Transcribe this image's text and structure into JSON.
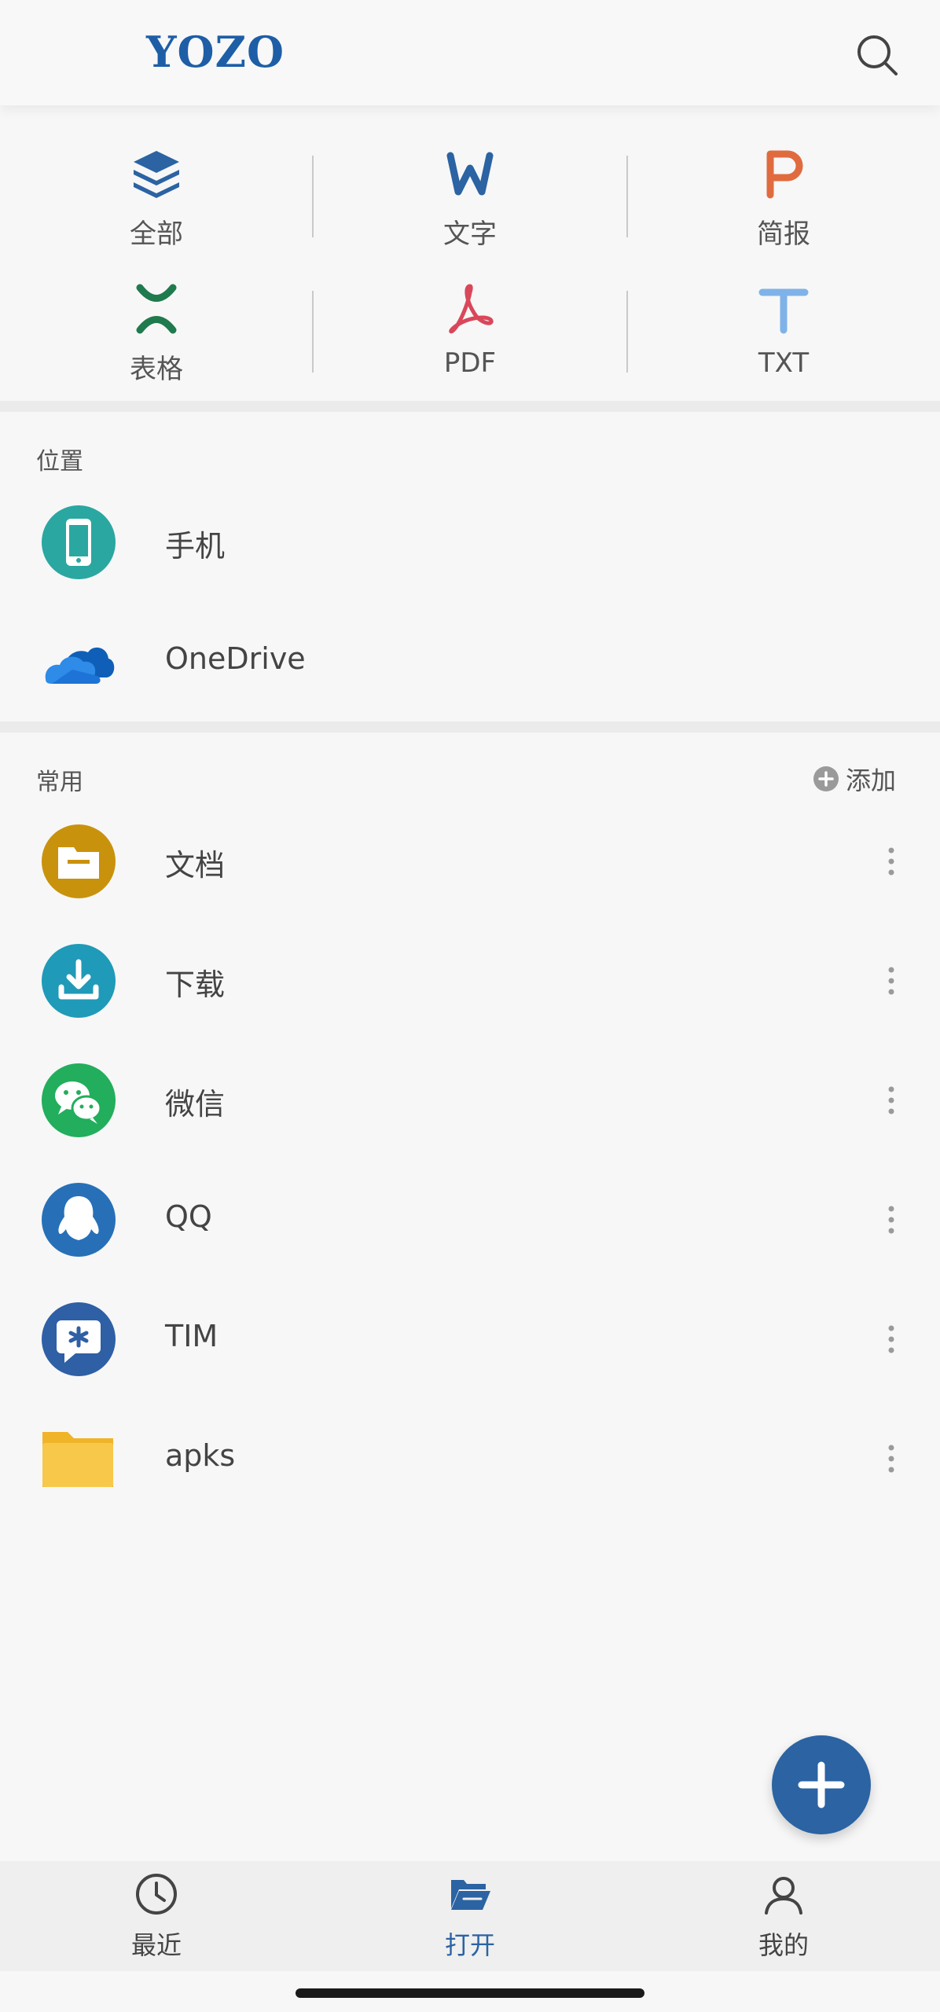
{
  "header": {
    "logo_text": "YOZO",
    "search_icon": "search-icon"
  },
  "categories": [
    {
      "label": "全部",
      "icon": "layers-icon",
      "color": "#2b63a3"
    },
    {
      "label": "文字",
      "icon": "word-icon",
      "color": "#2b63a3"
    },
    {
      "label": "简报",
      "icon": "presentation-icon",
      "color": "#e06b3f"
    },
    {
      "label": "表格",
      "icon": "spreadsheet-icon",
      "color": "#1f7a4d"
    },
    {
      "label": "PDF",
      "icon": "pdf-icon",
      "color": "#d9475a"
    },
    {
      "label": "TXT",
      "icon": "text-icon",
      "color": "#7fb2e8"
    }
  ],
  "locations": {
    "title": "位置",
    "items": [
      {
        "label": "手机",
        "icon": "phone-icon",
        "color": "#2aa7a0"
      },
      {
        "label": "OneDrive",
        "icon": "onedrive-icon",
        "color": "#1e72d6"
      }
    ]
  },
  "favorites": {
    "title": "常用",
    "add_label": "添加",
    "items": [
      {
        "label": "文档",
        "icon": "documents-folder-icon",
        "color": "#c9920d"
      },
      {
        "label": "下载",
        "icon": "download-icon",
        "color": "#1f9ab8"
      },
      {
        "label": "微信",
        "icon": "wechat-icon",
        "color": "#22ae5c"
      },
      {
        "label": "QQ",
        "icon": "qq-icon",
        "color": "#2770b8"
      },
      {
        "label": "TIM",
        "icon": "tim-icon",
        "color": "#2f5fa5"
      },
      {
        "label": "apks",
        "icon": "folder-icon",
        "color": "#f7c84a"
      }
    ]
  },
  "tabs": [
    {
      "label": "最近",
      "icon": "clock-icon",
      "active": false
    },
    {
      "label": "打开",
      "icon": "open-folder-icon",
      "active": true
    },
    {
      "label": "我的",
      "icon": "person-icon",
      "active": false
    }
  ],
  "colors": {
    "accent": "#2b63a3",
    "background": "#f7f7f7"
  }
}
